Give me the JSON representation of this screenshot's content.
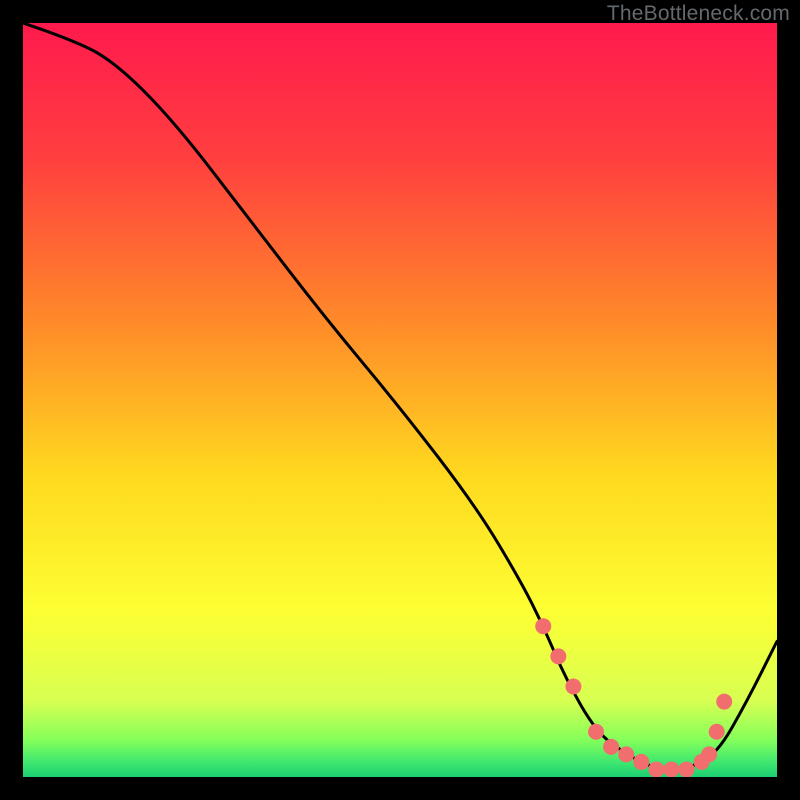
{
  "watermark": "TheBottleneck.com",
  "chart_data": {
    "type": "line",
    "title": "",
    "xlabel": "",
    "ylabel": "",
    "xlim": [
      0,
      100
    ],
    "ylim": [
      0,
      100
    ],
    "series": [
      {
        "name": "bottleneck-curve",
        "x": [
          0,
          6,
          12,
          20,
          30,
          40,
          50,
          60,
          66,
          69,
          72,
          76,
          80,
          84,
          88,
          92,
          96,
          100
        ],
        "y": [
          100,
          98,
          95,
          87,
          74,
          61,
          49,
          36,
          26,
          20,
          13,
          6,
          3,
          1,
          1,
          3,
          10,
          18
        ]
      }
    ],
    "markers": {
      "name": "optimal-zone-dots",
      "x": [
        69,
        71,
        73,
        76,
        78,
        80,
        82,
        84,
        86,
        88,
        90,
        91,
        92,
        93
      ],
      "y": [
        20,
        16,
        12,
        6,
        4,
        3,
        2,
        1,
        1,
        1,
        2,
        3,
        6,
        10
      ]
    },
    "gradient_stops": [
      {
        "offset": 0.0,
        "color": "#ff1a4d"
      },
      {
        "offset": 0.18,
        "color": "#ff3f3f"
      },
      {
        "offset": 0.4,
        "color": "#ff8b29"
      },
      {
        "offset": 0.6,
        "color": "#ffd91f"
      },
      {
        "offset": 0.78,
        "color": "#fdff33"
      },
      {
        "offset": 0.9,
        "color": "#d7ff52"
      },
      {
        "offset": 0.95,
        "color": "#86ff5a"
      },
      {
        "offset": 0.98,
        "color": "#3fe86f"
      },
      {
        "offset": 1.0,
        "color": "#1ccf72"
      }
    ],
    "marker_color": "#f26d6d",
    "curve_color": "#000000"
  }
}
